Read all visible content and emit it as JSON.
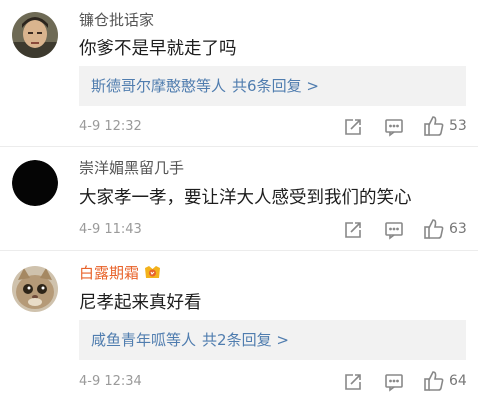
{
  "comments": [
    {
      "username": "镰仓批话家",
      "text": "你爹不是早就走了吗",
      "replies": {
        "who": "斯德哥尔摩憨憨",
        "etc": "等人",
        "more": "共6条回复 >"
      },
      "time": "4-9 12:32",
      "likes": "53"
    },
    {
      "username": "崇洋媚黑留几手",
      "text": "大家孝一孝，要让洋大人感受到我们的笑心",
      "time": "4-9 11:43",
      "likes": "63"
    },
    {
      "username": "白露期霜",
      "text": "尼孝起来真好看",
      "replies": {
        "who": "咸鱼青年呱",
        "etc": "等人",
        "more": "共2条回复 >"
      },
      "time": "4-9 12:34",
      "likes": "64"
    }
  ],
  "colors": {
    "link": "#507daf",
    "vip_name": "#e8632b",
    "meta": "#9a9a9a"
  },
  "icons": [
    "share-icon",
    "comment-icon",
    "like-icon",
    "vip-badge-icon"
  ]
}
